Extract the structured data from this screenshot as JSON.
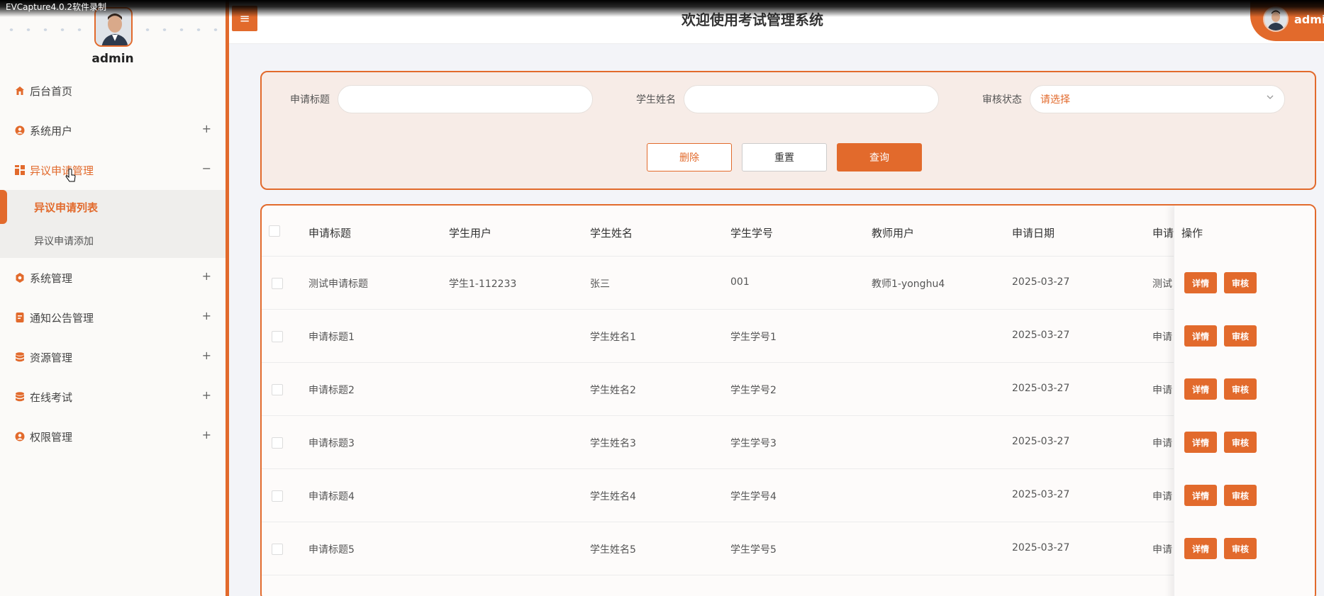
{
  "recorder": {
    "text": "EVCapture4.0.2软件录制"
  },
  "sidebar": {
    "admin_name": "admin",
    "menu": [
      {
        "label": "后台首页",
        "icon": "home-icon",
        "expandable": false
      },
      {
        "label": "系统用户",
        "icon": "user-icon",
        "expandable": true,
        "toggle": "+"
      },
      {
        "label": "异议申请管理",
        "icon": "grid-icon",
        "expandable": true,
        "toggle": "−"
      },
      {
        "label": "系统管理",
        "icon": "gear-icon",
        "expandable": true,
        "toggle": "+"
      },
      {
        "label": "通知公告管理",
        "icon": "notice-icon",
        "expandable": true,
        "toggle": "+"
      },
      {
        "label": "资源管理",
        "icon": "database-icon",
        "expandable": true,
        "toggle": "+"
      },
      {
        "label": "在线考试",
        "icon": "exam-icon",
        "expandable": true,
        "toggle": "+"
      },
      {
        "label": "权限管理",
        "icon": "permission-icon",
        "expandable": true,
        "toggle": "+"
      }
    ],
    "submenu": [
      {
        "label": "异议申请列表",
        "active": true
      },
      {
        "label": "异议申请添加",
        "active": false
      }
    ]
  },
  "header": {
    "menu_icon": "≡",
    "title": "欢迎使用考试管理系统",
    "user": "admin"
  },
  "search": {
    "title_label": "申请标题",
    "title_value": "",
    "student_label": "学生姓名",
    "student_value": "",
    "status_label": "审核状态",
    "status_placeholder": "请选择",
    "delete_label": "删除",
    "reset_label": "重置",
    "query_label": "查询"
  },
  "table": {
    "headers": [
      "申请标题",
      "学生用户",
      "学生姓名",
      "学生学号",
      "教师用户",
      "申请日期",
      "申请",
      "操作"
    ],
    "rows": [
      [
        "测试申请标题",
        "学生1-112233",
        "张三",
        "001",
        "教师1-yonghu4",
        "2025-03-27",
        "测试"
      ],
      [
        "申请标题1",
        "",
        "学生姓名1",
        "学生学号1",
        "",
        "2025-03-27",
        "申请"
      ],
      [
        "申请标题2",
        "",
        "学生姓名2",
        "学生学号2",
        "",
        "2025-03-27",
        "申请"
      ],
      [
        "申请标题3",
        "",
        "学生姓名3",
        "学生学号3",
        "",
        "2025-03-27",
        "申请"
      ],
      [
        "申请标题4",
        "",
        "学生姓名4",
        "学生学号4",
        "",
        "2025-03-27",
        "申请"
      ],
      [
        "申请标题5",
        "",
        "学生姓名5",
        "学生学号5",
        "",
        "2025-03-27",
        "申请"
      ]
    ],
    "detail_label": "详情",
    "review_label": "审核"
  },
  "colors": {
    "accent": "#e26a2c",
    "panel_bg": "#f7ece7"
  }
}
